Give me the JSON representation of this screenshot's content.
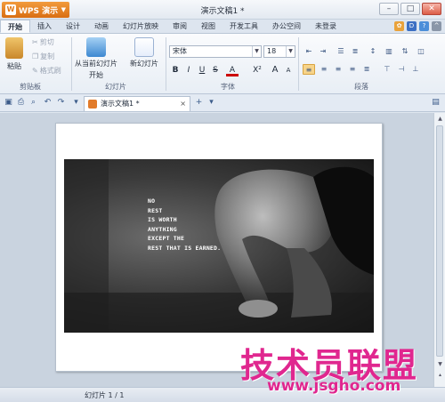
{
  "app": {
    "name": "WPS 演示",
    "window_title": "演示文稿1 *"
  },
  "ribbon_tabs": [
    "开始",
    "插入",
    "设计",
    "动画",
    "幻灯片放映",
    "审阅",
    "视图",
    "开发工具",
    "办公空间",
    "未登录"
  ],
  "clipboard": {
    "paste": "粘贴",
    "cut": "剪切",
    "copy": "复制",
    "format_painter": "格式刷",
    "group": "剪贴板"
  },
  "slides_group": {
    "from_current": "从当前幻灯片",
    "from_current_sub": "开始",
    "new_slide": "新幻灯片",
    "group": "幻灯片"
  },
  "font_group": {
    "font_name": "宋体",
    "font_size": "18",
    "bold": "B",
    "italic": "I",
    "underline": "U",
    "strike": "S",
    "font_color": "A",
    "superscript": "X²",
    "grow": "A",
    "shrink": "A",
    "group": "字体"
  },
  "paragraph_group": {
    "group": "段落"
  },
  "document_tab": {
    "title": "演示文稿1 *"
  },
  "slide_content": {
    "quote": [
      "NO",
      "REST",
      "IS WORTH",
      "ANYTHING",
      "EXCEPT THE",
      "REST THAT IS EARNED."
    ]
  },
  "status": {
    "slide_counter": "幻灯片 1 / 1"
  },
  "watermark": {
    "title": "技术员联盟",
    "url": "www.jsgho.com"
  },
  "colors": {
    "accent": "#e07a1a",
    "watermark": "#e0278f"
  }
}
